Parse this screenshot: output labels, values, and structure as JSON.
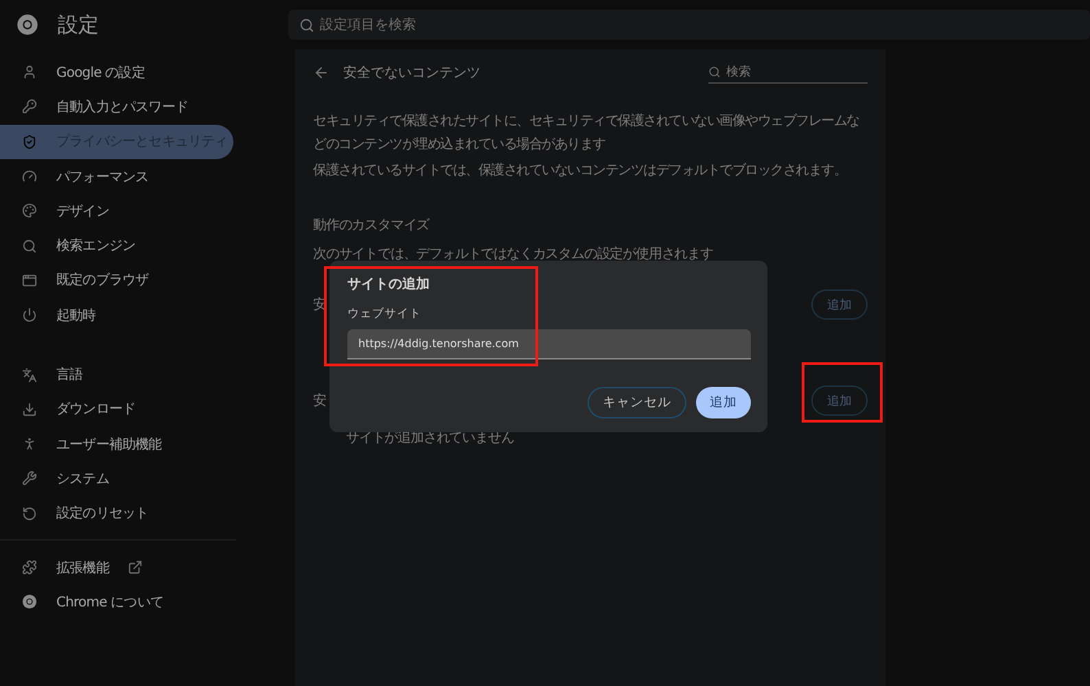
{
  "header": {
    "title": "設定",
    "search": {
      "placeholder": "設定項目を検索"
    }
  },
  "sidebar": {
    "groups": [
      [
        {
          "label": "Google の設定",
          "selected": false,
          "kind": "page"
        },
        {
          "label": "自動入力とパスワード",
          "selected": false,
          "kind": "page"
        },
        {
          "label": "プライバシーとセキュリティ",
          "selected": true,
          "kind": "page"
        },
        {
          "label": "パフォーマンス",
          "selected": false,
          "kind": "page"
        },
        {
          "label": "デザイン",
          "selected": false,
          "kind": "page"
        },
        {
          "label": "検索エンジン",
          "selected": false,
          "kind": "page"
        },
        {
          "label": "既定のブラウザ",
          "selected": false,
          "kind": "page"
        },
        {
          "label": "起動時",
          "selected": false,
          "kind": "page"
        }
      ],
      [
        {
          "label": "言語",
          "selected": false,
          "kind": "page"
        },
        {
          "label": "ダウンロード",
          "selected": false,
          "kind": "page"
        },
        {
          "label": "ユーザー補助機能",
          "selected": false,
          "kind": "page"
        },
        {
          "label": "システム",
          "selected": false,
          "kind": "page"
        },
        {
          "label": "設定のリセット",
          "selected": false,
          "kind": "page"
        }
      ],
      [
        {
          "label": "拡張機能",
          "selected": false,
          "kind": "external"
        },
        {
          "label": "Chrome について",
          "selected": false,
          "kind": "page"
        }
      ]
    ]
  },
  "content": {
    "title": "安全でないコンテンツ",
    "search": {
      "placeholder": "検索"
    },
    "paragraphs": [
      "セキュリティで保護されたサイトに、セキュリティで保護されていない画像やウェブフレームなどのコンテンツが埋め込まれている場合があります",
      "保護されているサイトでは、保護されていないコンテンツはデフォルトでブロックされます。"
    ],
    "section_title": "動作のカスタマイズ",
    "section_note": "次のサイトでは、デフォルトではなくカスタムの設定が使用されます",
    "rows": [
      {
        "label": "安",
        "button": "追加"
      },
      {
        "label": "安",
        "button": "追加"
      }
    ],
    "empty_note": "サイトが追加されていません"
  },
  "dialog": {
    "title": "サイトの追加",
    "field_label": "ウェブサイト",
    "value": "https://4ddig.tenorshare.com",
    "buttons": [
      {
        "label": "キャンセル",
        "kind": "secondary"
      },
      {
        "label": "追加",
        "kind": "primary"
      }
    ]
  }
}
